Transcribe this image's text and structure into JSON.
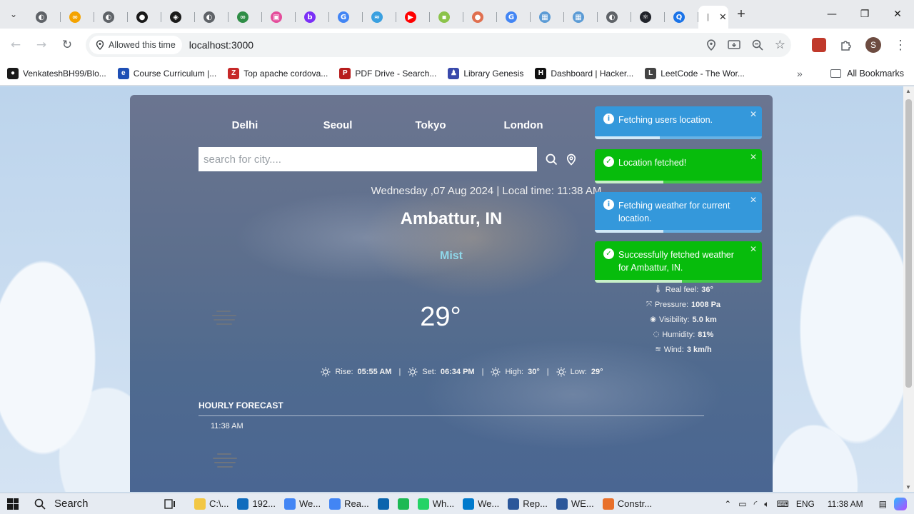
{
  "browser": {
    "tabs": [
      {
        "color": "#5f6368",
        "glyph": "◐"
      },
      {
        "color": "#f4a300",
        "glyph": "∞"
      },
      {
        "color": "#5f6368",
        "glyph": "◐"
      },
      {
        "color": "#1a1a1a",
        "glyph": "●"
      },
      {
        "color": "#1a1a1a",
        "glyph": "◈"
      },
      {
        "color": "#5f6368",
        "glyph": "◐"
      },
      {
        "color": "#2f8d46",
        "glyph": "∞"
      },
      {
        "color": "#e44d9b",
        "glyph": "▣"
      },
      {
        "color": "#7b2ff7",
        "glyph": "b"
      },
      {
        "color": "#4285f4",
        "glyph": "G"
      },
      {
        "color": "#3aa0e0",
        "glyph": "≈"
      },
      {
        "color": "#ff0000",
        "glyph": "▶"
      },
      {
        "color": "#8bc34a",
        "glyph": "▪"
      },
      {
        "color": "#e07050",
        "glyph": "●"
      },
      {
        "color": "#4285f4",
        "glyph": "G"
      },
      {
        "color": "#5b9bd5",
        "glyph": "▦"
      },
      {
        "color": "#5b9bd5",
        "glyph": "▦"
      },
      {
        "color": "#5f6368",
        "glyph": "◐"
      },
      {
        "color": "#20232a",
        "glyph": "⚛"
      },
      {
        "color": "#1a73e8",
        "glyph": "Q"
      }
    ],
    "active_tab_glyph": "|",
    "permission_chip": "Allowed this time",
    "url": "localhost:3000",
    "profile_initial": "S",
    "bookmarks": [
      {
        "label": "VenkateshBH99/Blo...",
        "color": "#1a1a1a",
        "glyph": "●"
      },
      {
        "label": "Course Curriculum |...",
        "color": "#1e4fb5",
        "glyph": "e"
      },
      {
        "label": "Top apache cordova...",
        "color": "#c62828",
        "glyph": "Z"
      },
      {
        "label": "PDF Drive - Search...",
        "color": "#b71c1c",
        "glyph": "P"
      },
      {
        "label": "Library Genesis",
        "color": "#3949ab",
        "glyph": "♟"
      },
      {
        "label": "Dashboard | Hacker...",
        "color": "#111111",
        "glyph": "H"
      },
      {
        "label": "LeetCode - The Wor...",
        "color": "#444444",
        "glyph": "L"
      }
    ],
    "bookmarks_more": "»",
    "all_bookmarks": "All Bookmarks"
  },
  "app": {
    "cities": [
      "Delhi",
      "Seoul",
      "Tokyo",
      "London"
    ],
    "search_placeholder": "search for city....",
    "datetime": "Wednesday ,07 Aug 2024 | Local time: 11:38 AM",
    "location": "Ambattur, IN",
    "condition": "Mist",
    "temperature": "29°",
    "details": [
      {
        "icon": "thermometer-icon",
        "label": "Real feel:",
        "value": "36°"
      },
      {
        "icon": "pressure-icon",
        "label": "Pressure:",
        "value": "1008 Pa"
      },
      {
        "icon": "eye-icon",
        "label": "Visibility:",
        "value": "5.0 km"
      },
      {
        "icon": "droplet-icon",
        "label": "Humidity:",
        "value": "81%"
      },
      {
        "icon": "wind-icon",
        "label": "Wind:",
        "value": "3 km/h"
      }
    ],
    "sun": [
      {
        "label": "Rise:",
        "value": "05:55 AM"
      },
      {
        "label": "Set:",
        "value": "06:34 PM"
      },
      {
        "label": "High:",
        "value": "30°"
      },
      {
        "label": "Low:",
        "value": "29°"
      }
    ],
    "hourly_title": "HOURLY FORECAST",
    "hourly": [
      {
        "time": "11:38 AM"
      }
    ]
  },
  "toasts": [
    {
      "type": "info",
      "text": "Fetching users location.",
      "progress": 0.39
    },
    {
      "type": "success",
      "text": "Location fetched!",
      "progress": 0.41
    },
    {
      "type": "info",
      "text": "Fetching weather for current location.",
      "progress": 0.41
    },
    {
      "type": "success",
      "text": "Successfully fetched weather for Ambattur, IN.",
      "progress": 0.52
    }
  ],
  "taskbar": {
    "search_label": "Search",
    "apps": [
      {
        "label": "C:\\...",
        "color": "#f2c744"
      },
      {
        "label": "192...",
        "color": "#0f6cbd"
      },
      {
        "label": "We...",
        "color": "#4285f4"
      },
      {
        "label": "Rea...",
        "color": "#4285f4"
      },
      {
        "label": "",
        "color": "#0a64ad"
      },
      {
        "label": "",
        "color": "#1db954"
      },
      {
        "label": "Wh...",
        "color": "#25d366"
      },
      {
        "label": "We...",
        "color": "#007acc"
      },
      {
        "label": "Rep...",
        "color": "#2b579a"
      },
      {
        "label": "WE...",
        "color": "#2b579a"
      },
      {
        "label": "Constr...",
        "color": "#e8702a"
      }
    ],
    "language": "ENG",
    "clock": "11:38 AM"
  }
}
